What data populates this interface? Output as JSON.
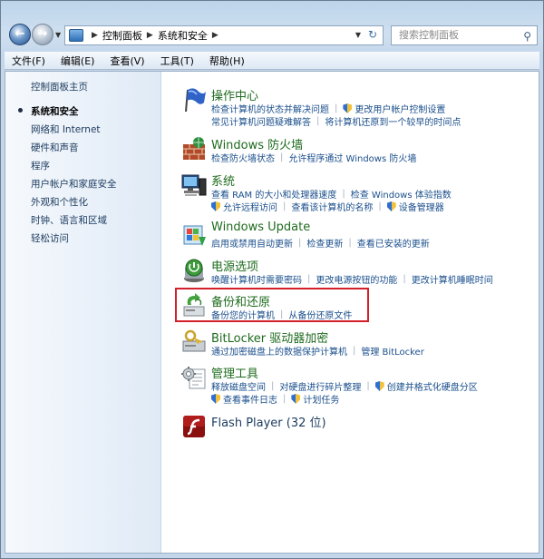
{
  "address": {
    "crumbs": [
      "控制面板",
      "系统和安全"
    ],
    "search_placeholder": "搜索控制面板"
  },
  "menu": [
    "文件(F)",
    "编辑(E)",
    "查看(V)",
    "工具(T)",
    "帮助(H)"
  ],
  "sidebar": {
    "items": [
      {
        "label": "控制面板主页",
        "current": false
      },
      {
        "label": "系统和安全",
        "current": true
      },
      {
        "label": "网络和 Internet",
        "current": false
      },
      {
        "label": "硬件和声音",
        "current": false
      },
      {
        "label": "程序",
        "current": false
      },
      {
        "label": "用户帐户和家庭安全",
        "current": false
      },
      {
        "label": "外观和个性化",
        "current": false
      },
      {
        "label": "时钟、语言和区域",
        "current": false
      },
      {
        "label": "轻松访问",
        "current": false
      }
    ]
  },
  "categories": [
    {
      "title": "操作中心",
      "icon": "flag-icon",
      "lines": [
        [
          {
            "text": "检查计算机的状态并解决问题",
            "shield": false
          },
          {
            "text": "更改用户帐户控制设置",
            "shield": true
          }
        ],
        [
          {
            "text": "常见计算机问题疑难解答",
            "shield": false
          },
          {
            "text": "将计算机还原到一个较早的时间点",
            "shield": false
          }
        ]
      ]
    },
    {
      "title": "Windows 防火墙",
      "icon": "firewall-icon",
      "lines": [
        [
          {
            "text": "检查防火墙状态",
            "shield": false
          },
          {
            "text": "允许程序通过 Windows 防火墙",
            "shield": false
          }
        ]
      ]
    },
    {
      "title": "系统",
      "icon": "computer-icon",
      "lines": [
        [
          {
            "text": "查看 RAM 的大小和处理器速度",
            "shield": false
          },
          {
            "text": "检查 Windows 体验指数",
            "shield": false
          }
        ],
        [
          {
            "text": "允许远程访问",
            "shield": true
          },
          {
            "text": "查看该计算机的名称",
            "shield": false
          },
          {
            "text": "设备管理器",
            "shield": true
          }
        ]
      ]
    },
    {
      "title": "Windows Update",
      "icon": "windows-update-icon",
      "lines": [
        [
          {
            "text": "启用或禁用自动更新",
            "shield": false
          },
          {
            "text": "检查更新",
            "shield": false
          },
          {
            "text": "查看已安装的更新",
            "shield": false
          }
        ]
      ]
    },
    {
      "title": "电源选项",
      "icon": "power-icon",
      "lines": [
        [
          {
            "text": "唤醒计算机时需要密码",
            "shield": false
          },
          {
            "text": "更改电源按钮的功能",
            "shield": false
          },
          {
            "text": "更改计算机睡眠时间",
            "shield": false
          }
        ]
      ]
    },
    {
      "title": "备份和还原",
      "icon": "backup-icon",
      "lines": [
        [
          {
            "text": "备份您的计算机",
            "shield": false
          },
          {
            "text": "从备份还原文件",
            "shield": false
          }
        ]
      ]
    },
    {
      "title": "BitLocker 驱动器加密",
      "icon": "bitlocker-icon",
      "lines": [
        [
          {
            "text": "通过加密磁盘上的数据保护计算机",
            "shield": false
          },
          {
            "text": "管理 BitLocker",
            "shield": false
          }
        ]
      ]
    },
    {
      "title": "管理工具",
      "icon": "admin-tools-icon",
      "lines": [
        [
          {
            "text": "释放磁盘空间",
            "shield": false
          },
          {
            "text": "对硬盘进行碎片整理",
            "shield": false
          },
          {
            "text": "创建并格式化硬盘分区",
            "shield": true
          }
        ],
        [
          {
            "text": "查看事件日志",
            "shield": true
          },
          {
            "text": "计划任务",
            "shield": true
          }
        ]
      ]
    },
    {
      "title": "Flash Player (32 位)",
      "icon": "flash-icon",
      "lines": []
    }
  ]
}
